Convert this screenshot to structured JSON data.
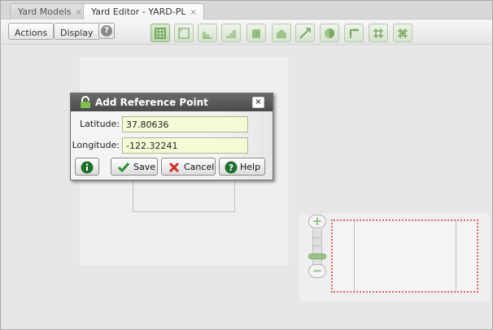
{
  "tabs": [
    {
      "label": "Yard Models",
      "close": "×"
    },
    {
      "label": "Yard Editor - YARD-PL",
      "close": "×"
    }
  ],
  "toolbar": {
    "actions_label": "Actions",
    "display_label": "Display",
    "help_glyph": "?",
    "icons": [
      "select-tool-icon",
      "rectangle-tool-icon",
      "area-tool-icon",
      "stairs-tool-icon",
      "building-tool-icon",
      "shed-tool-icon",
      "line-tool-icon",
      "circle-tool-icon",
      "corner-track-icon",
      "junction-track-icon",
      "cross-track-icon"
    ]
  },
  "dialog": {
    "title": "Add Reference Point",
    "close_glyph": "×",
    "latitude_label": "Latitude:",
    "latitude_value": "37.80636",
    "longitude_label": "Longitude:",
    "longitude_value": "-122.32241",
    "save_label": "Save",
    "cancel_label": "Cancel",
    "help_label": "Help"
  },
  "zoom": {
    "in_glyph": "+",
    "out_glyph": "−",
    "level": 0.2
  },
  "colors": {
    "accent_green": "#8db87a",
    "dialog_title": "#4a4a4a",
    "minimap_border": "#e3635b",
    "field_bg": "#f4fbd6"
  }
}
